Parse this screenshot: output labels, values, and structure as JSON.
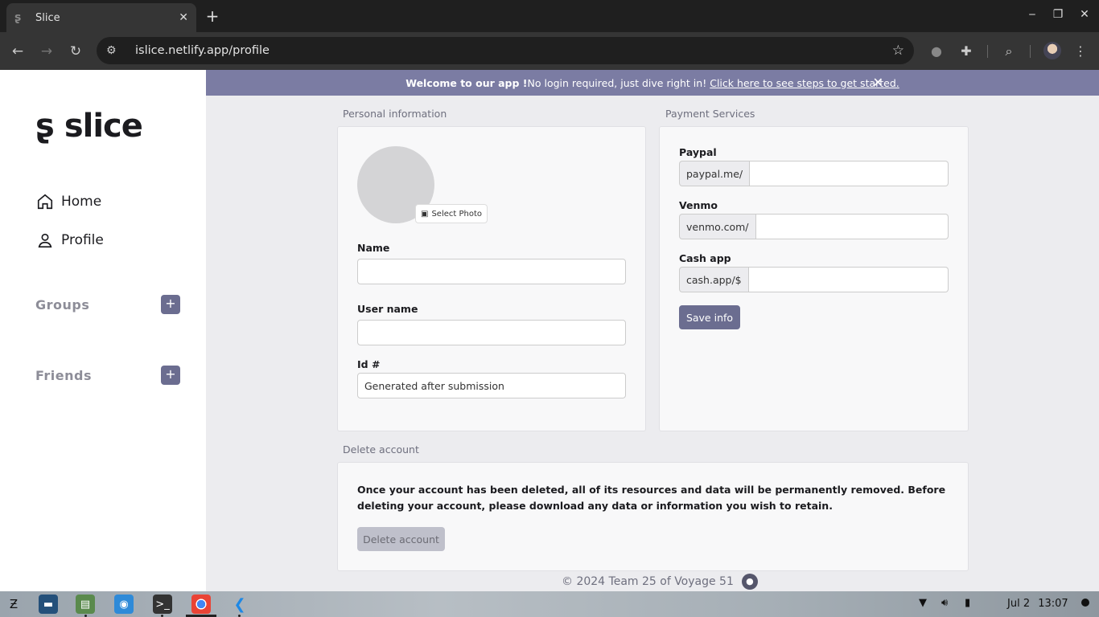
{
  "browser": {
    "tab_title": "Slice",
    "tab_close": "✕",
    "new_tab": "+",
    "url": "islice.netlify.app/profile",
    "window_controls": [
      "‒",
      "❐",
      "✕"
    ]
  },
  "sidebar": {
    "logo_text": "slice",
    "nav": [
      {
        "label": "Home",
        "icon": "home-icon"
      },
      {
        "label": "Profile",
        "icon": "user-icon"
      }
    ],
    "groups_label": "Groups",
    "friends_label": "Friends",
    "add_symbol": "+"
  },
  "banner": {
    "bold": "Welcome to our app !",
    "text": " No login required, just dive right in!",
    "link": "Click here to see steps to get started.",
    "close": "✕"
  },
  "personal": {
    "section_title": "Personal information",
    "select_photo": "Select Photo",
    "name_label": "Name",
    "name_value": "",
    "username_label": "User name",
    "username_value": "",
    "id_label": "Id #",
    "id_value": "Generated after submission"
  },
  "payment": {
    "section_title": "Payment Services",
    "services": [
      {
        "label": "Paypal",
        "prefix": "paypal.me/"
      },
      {
        "label": "Venmo",
        "prefix": "venmo.com/"
      },
      {
        "label": "Cash app",
        "prefix": "cash.app/$"
      }
    ],
    "save_label": "Save info"
  },
  "delete": {
    "section_title": "Delete account",
    "text": "Once your account has been deleted, all of its resources and data will be permanently removed. Before deleting your account, please download any data or information you wish to retain.",
    "button": "Delete account"
  },
  "footer": {
    "text": "© 2024 Team 25 of Voyage 51"
  },
  "taskbar": {
    "date": "Jul 2",
    "time": "13:07"
  },
  "colors": {
    "accent": "#6b6d90",
    "banner": "#7b7ca3"
  }
}
